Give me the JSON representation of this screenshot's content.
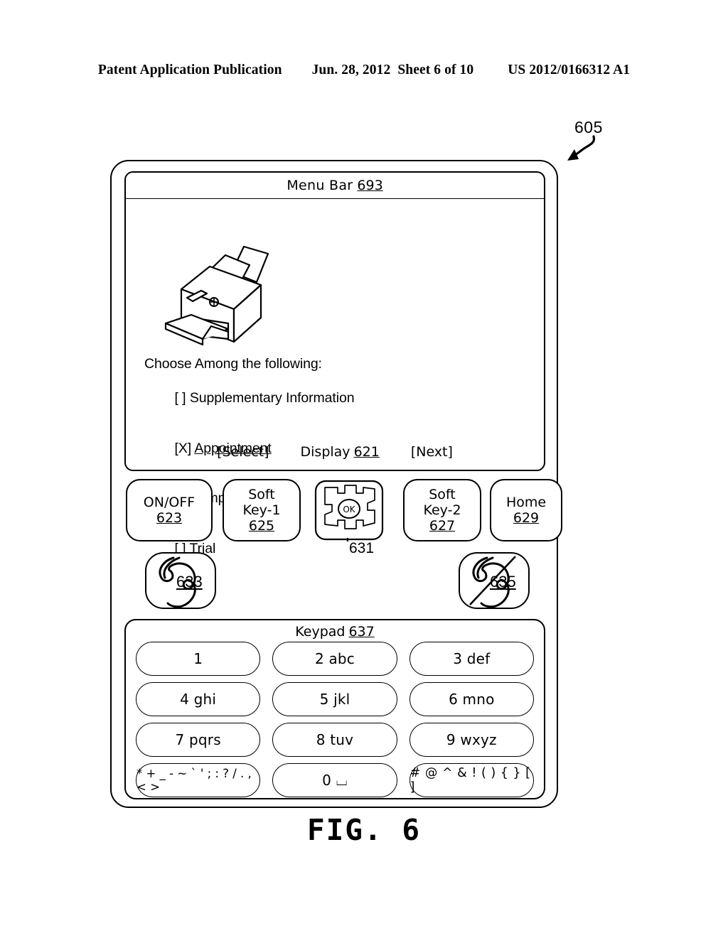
{
  "header": {
    "publication": "Patent Application Publication",
    "date": "Jun. 28, 2012",
    "sheet": "Sheet 6 of 10",
    "patent_number": "US 2012/0166312 A1"
  },
  "figure": {
    "caption": "FIG. 6",
    "device_reference": "605"
  },
  "device": {
    "display": {
      "menu_bar": {
        "label": "Menu Bar",
        "reference": "693"
      },
      "artwork": "printer-illustration",
      "prompt": "Choose Among the following:",
      "options": [
        {
          "marker": "[ ]",
          "label": "Supplementary Information",
          "selected": false
        },
        {
          "marker": "[X]",
          "label": "Appointment",
          "selected": true
        },
        {
          "marker": "[ ]",
          "label": "Sample",
          "selected": false
        },
        {
          "marker": "[ ]",
          "label": "Trial",
          "selected": false
        }
      ],
      "legend": {
        "left_softkey": "[Select]",
        "display_label": "Display",
        "display_reference": "621",
        "right_softkey": "[Next]"
      }
    },
    "controls": [
      {
        "label_line1": "ON/OFF",
        "label_line2": "",
        "reference": "623"
      },
      {
        "label_line1": "Soft",
        "label_line2": "Key-1",
        "reference": "625"
      },
      {
        "label_line1": "Soft",
        "label_line2": "Key-2",
        "reference": "627"
      },
      {
        "label_line1": "Home",
        "label_line2": "",
        "reference": "629"
      }
    ],
    "navigation_pad": {
      "center_label": "OK",
      "reference": "631"
    },
    "call_buttons": [
      {
        "icon": "phone-handset-icon",
        "reference": "633"
      },
      {
        "icon": "phone-handset-slashed-icon",
        "reference": "635"
      }
    ],
    "keypad": {
      "title": "Keypad",
      "reference": "637",
      "keys": [
        "1",
        "2 abc",
        "3 def",
        "4 ghi",
        "5 jkl",
        "6 mno",
        "7 pqrs",
        "8 tuv",
        "9 wxyz",
        "* + _ - ~ ` ' ; : ? / . , < >",
        "0 ⌴",
        "# @ ^ & ! ( ) { } [ ]"
      ]
    }
  }
}
